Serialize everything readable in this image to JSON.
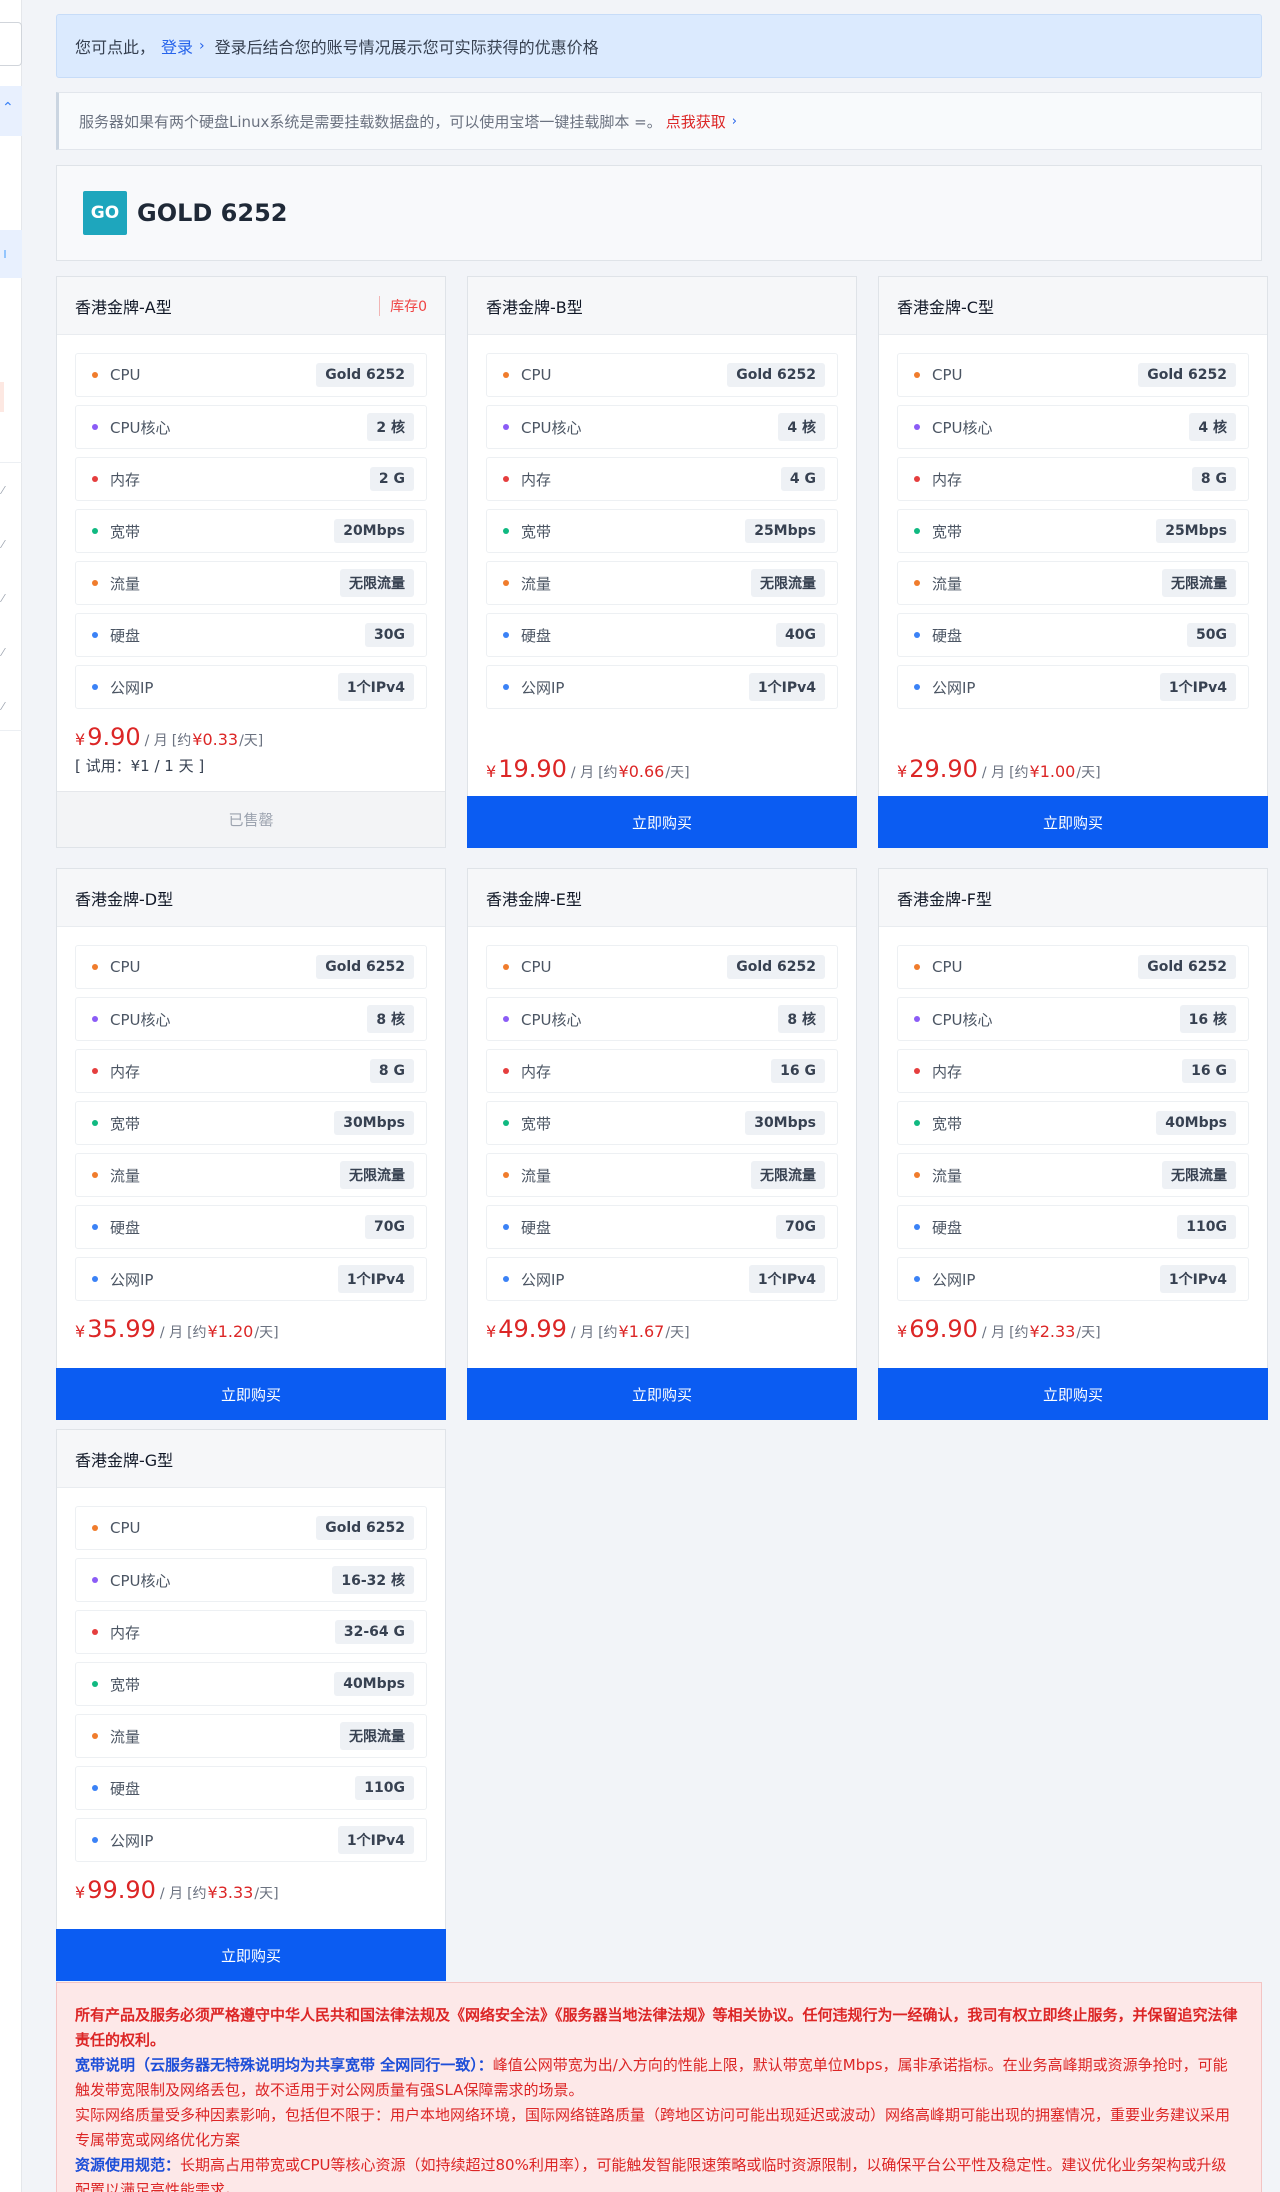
{
  "notice_login": {
    "prefix": "您可点此，",
    "link": "登录",
    "suffix": "登录后结合您的账号情况展示您可实际获得的优惠价格"
  },
  "notice_disk": {
    "text": "服务器如果有两个硬盘Linux系统是需要挂载数据盘的，可以使用宝塔一键挂载脚本 =。",
    "link": "点我获取"
  },
  "group": {
    "badge": "GO",
    "title": "GOLD 6252"
  },
  "spec_labels": {
    "cpu": "CPU",
    "cores": "CPU核心",
    "memory": "内存",
    "bandwidth": "宽带",
    "traffic": "流量",
    "disk": "硬盘",
    "ip": "公网IP"
  },
  "price_labels": {
    "currency": "¥",
    "per_month": "/ 月",
    "approx_open": "[约",
    "per_day": "/天]"
  },
  "colors": {
    "cpu": "#f07c2c",
    "cores": "#8b5cf6",
    "memory": "#e53e3e",
    "bandwidth": "#10b981",
    "traffic": "#f07c2c",
    "disk": "#3b82f6",
    "ip": "#3b82f6",
    "buy_button": "#0b5cf2",
    "price": "#dc2626"
  },
  "products": [
    {
      "title": "香港金牌-A型",
      "stock": "库存0",
      "cpu": "Gold 6252",
      "cores": "2 核",
      "memory": "2 G",
      "bandwidth": "20Mbps",
      "traffic": "无限流量",
      "disk": "30G",
      "ip": "1个IPv4",
      "price": "9.90",
      "daily": "¥0.33",
      "trial": "[ 试用：¥1 / 1 天 ]",
      "button": "已售罄"
    },
    {
      "title": "香港金牌-B型",
      "cpu": "Gold 6252",
      "cores": "4 核",
      "memory": "4 G",
      "bandwidth": "25Mbps",
      "traffic": "无限流量",
      "disk": "40G",
      "ip": "1个IPv4",
      "price": "19.90",
      "daily": "¥0.66",
      "button": "立即购买"
    },
    {
      "title": "香港金牌-C型",
      "cpu": "Gold 6252",
      "cores": "4 核",
      "memory": "8 G",
      "bandwidth": "25Mbps",
      "traffic": "无限流量",
      "disk": "50G",
      "ip": "1个IPv4",
      "price": "29.90",
      "daily": "¥1.00",
      "button": "立即购买"
    },
    {
      "title": "香港金牌-D型",
      "cpu": "Gold 6252",
      "cores": "8 核",
      "memory": "8 G",
      "bandwidth": "30Mbps",
      "traffic": "无限流量",
      "disk": "70G",
      "ip": "1个IPv4",
      "price": "35.99",
      "daily": "¥1.20",
      "button": "立即购买"
    },
    {
      "title": "香港金牌-E型",
      "cpu": "Gold 6252",
      "cores": "8 核",
      "memory": "16 G",
      "bandwidth": "30Mbps",
      "traffic": "无限流量",
      "disk": "70G",
      "ip": "1个IPv4",
      "price": "49.99",
      "daily": "¥1.67",
      "button": "立即购买"
    },
    {
      "title": "香港金牌-F型",
      "cpu": "Gold 6252",
      "cores": "16 核",
      "memory": "16 G",
      "bandwidth": "40Mbps",
      "traffic": "无限流量",
      "disk": "110G",
      "ip": "1个IPv4",
      "price": "69.90",
      "daily": "¥2.33",
      "button": "立即购买"
    },
    {
      "title": "香港金牌-G型",
      "cpu": "Gold 6252",
      "cores": "16-32 核",
      "memory": "32-64 G",
      "bandwidth": "40Mbps",
      "traffic": "无限流量",
      "disk": "110G",
      "ip": "1个IPv4",
      "price": "99.90",
      "daily": "¥3.33",
      "button": "立即购买"
    }
  ],
  "legal": {
    "line1": "所有产品及服务必须严格遵守中华人民共和国法律法规及《网络安全法》《服务器当地法律法规》等相关协议。任何违规行为一经确认，我司有权立即终止服务，并保留追究法律责任的权利。",
    "bw_title": "宽带说明（云服务器无特殊说明均为共享宽带 全网同行一致）：",
    "bw_text": "峰值公网带宽为出/入方向的性能上限，默认带宽单位Mbps，属非承诺指标。在业务高峰期或资源争抢时，可能触发带宽限制及网络丢包，故不适用于对公网质量有强SLA保障需求的场景。",
    "net_text": "实际网络质量受多种因素影响，包括但不限于：用户本地网络环境，国际网络链路质量（跨地区访问可能出现延迟或波动）网络高峰期可能出现的拥塞情况，重要业务建议采用专属带宽或网络优化方案",
    "res_title": "资源使用规范：",
    "res_text": "长期高占用带宽或CPU等核心资源（如持续超过80%利用率），可能触发智能限速策略或临时资源限制，以确保平台公平性及稳定性。建议优化业务架构或升级配置以满足高性能需求。"
  }
}
